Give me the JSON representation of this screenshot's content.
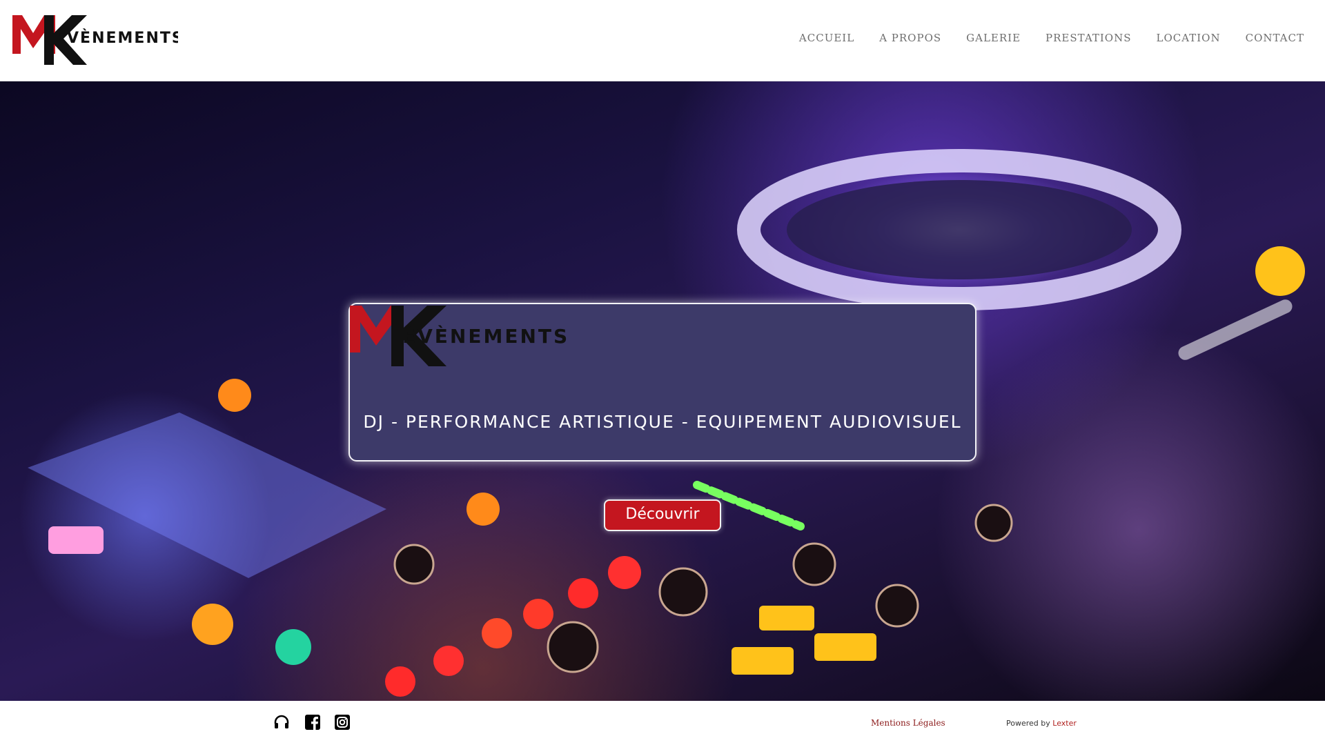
{
  "brand": {
    "logo_text": "ÉVÈNEMENTS",
    "logo_mark": "M"
  },
  "nav": {
    "items": [
      "ACCUEIL",
      "A PROPOS",
      "GALERIE",
      "PRESTATIONS",
      "LOCATION",
      "CONTACT"
    ]
  },
  "hero": {
    "card_logo_text": "ÉVÈNEMENTS",
    "tagline": "DJ - PERFORMANCE ARTISTIQUE - EQUIPEMENT AUDIOVISUEL",
    "cta_label": "Découvrir"
  },
  "footer": {
    "social_icons": [
      "headphones-icon",
      "facebook-icon",
      "instagram-icon"
    ],
    "legal_label": "Mentions Légales",
    "powered_prefix": "Powered by",
    "powered_link": "Lexter"
  },
  "colors": {
    "brand_red": "#c4161f",
    "brand_black": "#111111",
    "card_bg": "#3d3a69",
    "nav_text": "#6e6e6e"
  }
}
